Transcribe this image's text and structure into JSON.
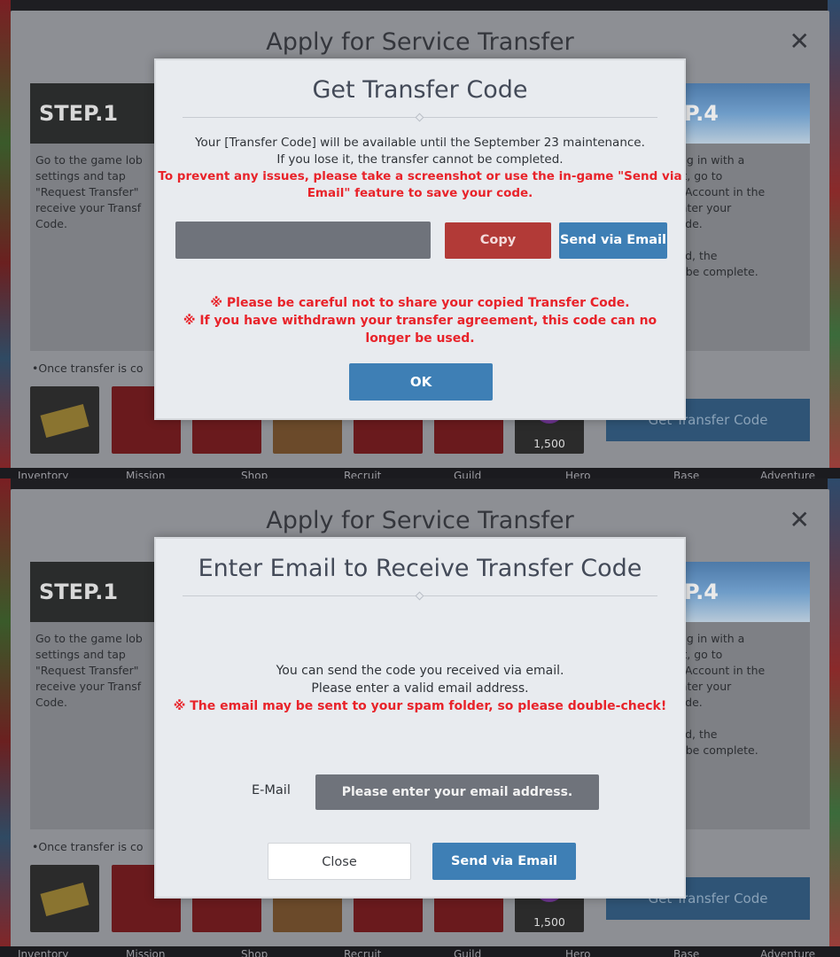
{
  "base": {
    "title": "Apply for Service Transfer",
    "close_glyph": "✕",
    "step1": {
      "label": "STEP.1",
      "lines": [
        "Go to the game lob",
        "settings and tap",
        "\"Request Transfer\"",
        "receive your Transf",
        "Code."
      ]
    },
    "step4": {
      "label": "P.4",
      "lines": [
        "ogging in with a",
        "count, go to",
        "gs > Account in the",
        "nd enter your",
        "er Code.",
        "",
        "ntered, the",
        "r will be complete."
      ]
    },
    "once_note": "•Once transfer is co",
    "reward_qty": "1,500",
    "get_code_button": "Get Transfer Code",
    "nav": [
      "Inventory",
      "Mission",
      "Shop",
      "Recruit",
      "Guild",
      "Hero",
      "Base",
      "Adventure"
    ]
  },
  "dialog1": {
    "title": "Get Transfer Code",
    "info_line1": "Your [Transfer Code] will be available until the September 23 maintenance.",
    "info_line2": "If you lose it, the transfer cannot be completed.",
    "warn_line1": "To prevent any issues, please take a screenshot or use the in-game \"Send via",
    "warn_line2": "Email\" feature to save your code.",
    "copy_button": "Copy",
    "send_email_button": "Send via Email",
    "caution_line1": "※ Please be careful not to share your copied Transfer Code.",
    "caution_line2": "※ If you have withdrawn your transfer agreement, this code can no",
    "caution_line3": "longer be used.",
    "ok_button": "OK"
  },
  "dialog2": {
    "title": "Enter Email to Receive Transfer Code",
    "info_line1": "You can send the code you received via email.",
    "info_line2": "Please enter a valid email address.",
    "warn_line1": "※ The email may be sent to your spam folder, so please double-check!",
    "email_label": "E-Mail",
    "email_placeholder": "Please enter your email address.",
    "close_button": "Close",
    "send_email_button": "Send via Email"
  },
  "colors": {
    "accent_blue": "#3e7fb5",
    "copy_red": "#b23a37",
    "warning_red": "#e8232a"
  }
}
